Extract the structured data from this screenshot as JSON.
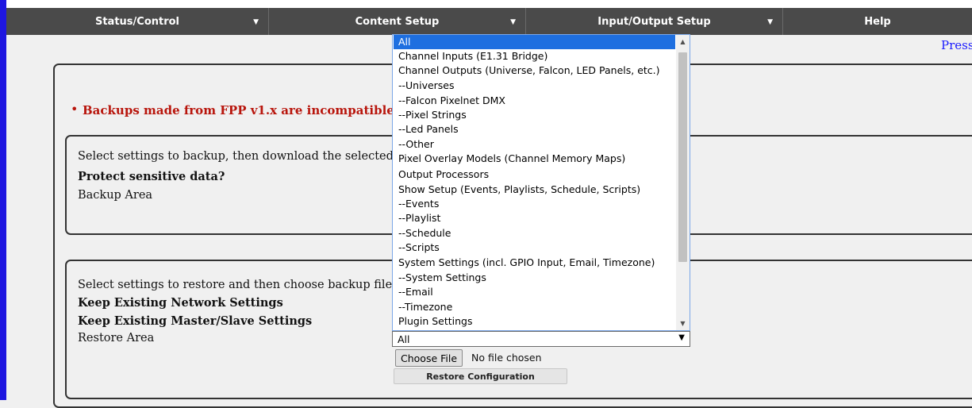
{
  "nav": {
    "items": [
      {
        "label": "Status/Control"
      },
      {
        "label": "Content Setup"
      },
      {
        "label": "Input/Output Setup"
      },
      {
        "label": "Help"
      }
    ]
  },
  "header": {
    "press_text": "Press"
  },
  "notice": {
    "warning": "Backups made from FPP v1.x are incompatible wi"
  },
  "backup": {
    "instructions": "Select settings to backup, then download the selected syst",
    "protect_label": "Protect sensitive data?",
    "area_label": "Backup Area"
  },
  "restore": {
    "instructions": "Select settings to restore and then choose backup file cont",
    "keep_network_label": "Keep Existing Network Settings",
    "keep_master_label": "Keep Existing Master/Slave Settings",
    "area_label": "Restore Area",
    "selected_value": "All",
    "choose_file_label": "Choose File",
    "file_status": "No file chosen",
    "restore_button_label": "Restore  Configuration"
  },
  "dropdown": {
    "options": [
      "All",
      "Channel Inputs (E1.31 Bridge)",
      "Channel Outputs (Universe, Falcon, LED Panels, etc.)",
      "--Universes",
      "--Falcon Pixelnet DMX",
      "--Pixel Strings",
      "--Led Panels",
      "--Other",
      "Pixel Overlay Models (Channel Memory Maps)",
      "Output Processors",
      "Show Setup (Events, Playlists, Schedule, Scripts)",
      "--Events",
      "--Playlist",
      "--Schedule",
      "--Scripts",
      "System Settings (incl. GPIO Input, Email, Timezone)",
      "--System Settings",
      "--Email",
      "--Timezone",
      "Plugin Settings"
    ],
    "selected_index": 0
  },
  "colors": {
    "nav_bg": "#4a4a4a",
    "warning": "#b8150c",
    "selection": "#1e6fe0",
    "left_bar": "#1e16e0"
  }
}
